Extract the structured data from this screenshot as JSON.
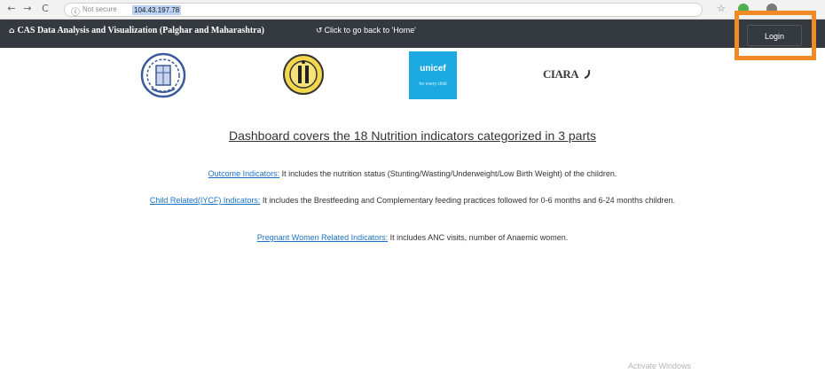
{
  "browser": {
    "security_label": "Not secure",
    "url": "104.43.197.78",
    "back": "←",
    "forward": "→",
    "reload": "C",
    "info_glyph": "ⓘ",
    "star_glyph": "☆"
  },
  "navbar": {
    "brand_icon": "⌂",
    "brand": "CAS Data Analysis and Visualization (Palghar and Maharashtra)",
    "home_icon": "↺",
    "home_link": "Click to go back to 'Home'",
    "login": "Login",
    "highlight_color": "#f08a24",
    "bar_color": "#343a40"
  },
  "logos": {
    "unicef": "unicef",
    "unicef_tagline": "for every child",
    "ciara": "CIARA"
  },
  "main": {
    "headline": "Dashboard covers the 18 Nutrition indicators categorized in 3 parts",
    "items": [
      {
        "link": "Outcome Indicators:",
        "text": " It includes the nutrition status (Stunting/Wasting/Underweight/Low Birth Weight) of the children."
      },
      {
        "link": "Child Related(IYCF) Indicators:",
        "text": " It includes the Brestfeeding and Complementary feeding practices followed for 0-6 months and 6-24 months children."
      },
      {
        "link": "Pregnant Women Related Indicators:",
        "text": " It includes ANC visits, number of Anaemic women."
      }
    ]
  },
  "watermark": "Activate Windows"
}
